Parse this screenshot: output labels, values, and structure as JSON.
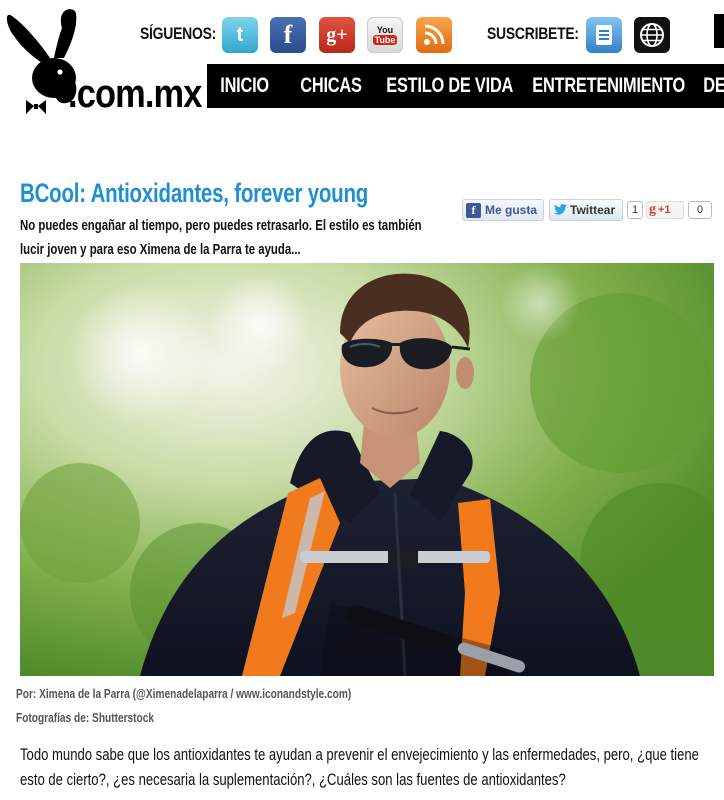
{
  "header": {
    "logo_text": ".com.mx",
    "social_label": "SÍGUENOS:",
    "subscribe_label": "SUSCRIBETE:",
    "social_icons": [
      "twitter-icon",
      "facebook-icon",
      "google-plus-icon",
      "youtube-icon",
      "rss-icon"
    ],
    "subscribe_icons": [
      "newsletter-icon",
      "globe-icon"
    ],
    "youtube_text_top": "You",
    "youtube_text_bottom": "Tube"
  },
  "nav": {
    "items": [
      "INICIO",
      "CHICAS",
      "ESTILO DE VIDA",
      "ENTRETENIMIENTO",
      "DE"
    ]
  },
  "article": {
    "title": "BCool: Antioxidantes, forever young",
    "summary": "No puedes engañar al tiempo, pero puedes retrasarlo. El estilo es también lucir joven y para eso Ximena de la Parra te ayuda...",
    "author_credit": "Por: Ximena de la Parra (@Ximenadelaparra / www.iconandstyle.com)",
    "photo_credit": "Fotografías de: Shutterstock",
    "body": "Todo mundo sabe que los antioxidantes te  ayudan a prevenir el envejecimiento y  las enfermedades, pero, ¿que tiene esto de cierto?, ¿es necesaria la suplementación?, ¿Cuáles son las fuentes de antioxidantes?"
  },
  "share": {
    "like_label": "Me gusta",
    "tweet_label": "Twittear",
    "tweet_count": "1",
    "gplus_label": "+1",
    "gplus_count": "0"
  },
  "colors": {
    "title_blue": "#1f8fd2",
    "nav_bg": "#000000",
    "facebook_blue": "#3b5998"
  }
}
